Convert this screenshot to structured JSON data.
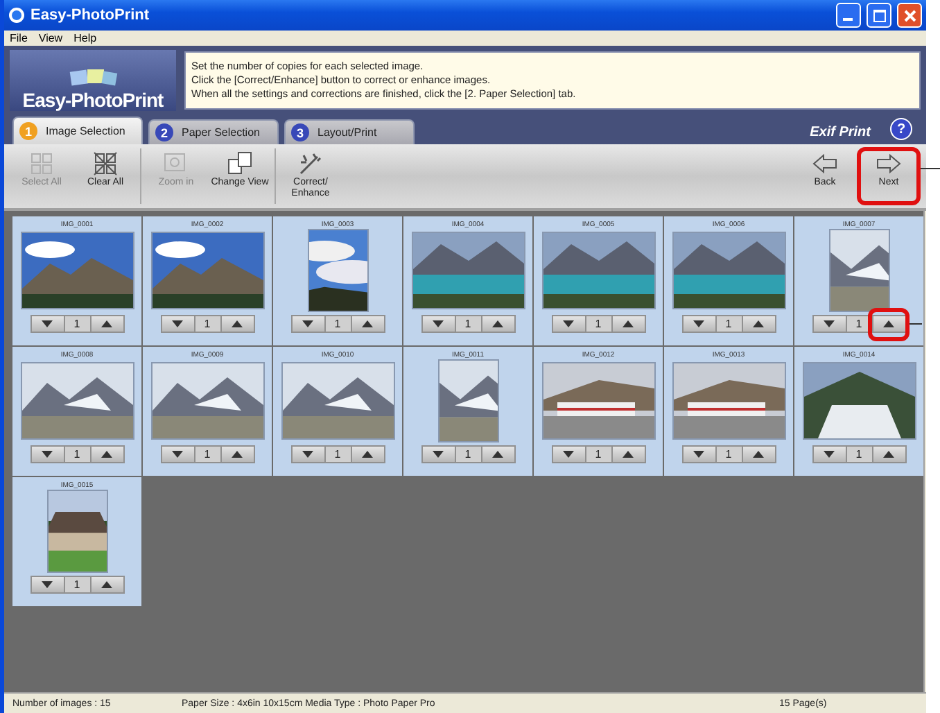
{
  "window": {
    "title": "Easy-PhotoPrint"
  },
  "menu": [
    "File",
    "View",
    "Help"
  ],
  "banner": {
    "logo": "Easy-PhotoPrint",
    "instructions": [
      "Set the number of copies for each selected image.",
      "Click the [Correct/Enhance] button to correct or enhance images.",
      "When all the settings and corrections are finished, click the [2. Paper Selection] tab."
    ]
  },
  "tabs": [
    {
      "number": "1",
      "label": "Image Selection",
      "selected": true
    },
    {
      "number": "2",
      "label": "Paper Selection",
      "selected": false
    },
    {
      "number": "3",
      "label": "Layout/Print",
      "selected": false
    }
  ],
  "brand": "Exif Print",
  "help": "?",
  "toolbar": [
    {
      "kind": "select",
      "label": "Select All",
      "disabled": true,
      "highlighted": false
    },
    {
      "kind": "clear",
      "label": "Clear All",
      "disabled": false,
      "highlighted": false
    },
    {
      "kind": "zoom",
      "label": "Zoom in",
      "disabled": true,
      "highlighted": false
    },
    {
      "kind": "view",
      "label": "Change View",
      "disabled": false,
      "highlighted": false
    },
    {
      "kind": "correct",
      "label": "Correct/ Enhance",
      "disabled": false,
      "highlighted": false
    },
    {
      "kind": "back",
      "label": "Back",
      "disabled": false,
      "highlighted": false
    },
    {
      "kind": "next",
      "label": "Next",
      "disabled": false,
      "highlighted": true
    }
  ],
  "images": [
    {
      "name": "IMG_0001",
      "copies": "1",
      "up_highlighted": false
    },
    {
      "name": "IMG_0002",
      "copies": "1",
      "up_highlighted": false
    },
    {
      "name": "IMG_0003",
      "copies": "1",
      "up_highlighted": false
    },
    {
      "name": "IMG_0004",
      "copies": "1",
      "up_highlighted": false
    },
    {
      "name": "IMG_0005",
      "copies": "1",
      "up_highlighted": false
    },
    {
      "name": "IMG_0006",
      "copies": "1",
      "up_highlighted": false
    },
    {
      "name": "IMG_0007",
      "copies": "1",
      "up_highlighted": true
    },
    {
      "name": "IMG_0008",
      "copies": "1",
      "up_highlighted": false
    },
    {
      "name": "IMG_0009",
      "copies": "1",
      "up_highlighted": false
    },
    {
      "name": "IMG_0010",
      "copies": "1",
      "up_highlighted": false
    },
    {
      "name": "IMG_0011",
      "copies": "1",
      "up_highlighted": false
    },
    {
      "name": "IMG_0012",
      "copies": "1",
      "up_highlighted": false
    },
    {
      "name": "IMG_0013",
      "copies": "1",
      "up_highlighted": false
    },
    {
      "name": "IMG_0014",
      "copies": "1",
      "up_highlighted": false
    },
    {
      "name": "IMG_0015",
      "copies": "1",
      "up_highlighted": false
    }
  ],
  "status_bar": [
    "Number of images : 15",
    "Paper Size : 4x6in 10x15cm  Media Type : Photo Paper Pro",
    "15 Page(s)"
  ]
}
